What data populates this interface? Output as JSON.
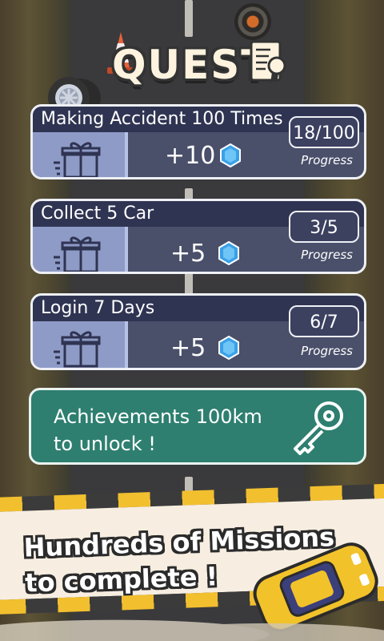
{
  "title": "QUEST",
  "quests": [
    {
      "name": "Making Accident 100 Times",
      "reward": "+10",
      "progress_value": "18/100",
      "progress_label": "Progress"
    },
    {
      "name": "Collect 5 Car",
      "reward": "+5",
      "progress_value": "3/5",
      "progress_label": "Progress"
    },
    {
      "name": "Login 7 Days",
      "reward": "+5",
      "progress_value": "6/7",
      "progress_label": "Progress"
    }
  ],
  "achievement": {
    "line1": "Achievements 100km",
    "line2": "to unlock !"
  },
  "banner": {
    "line1": "Hundreds of Missions",
    "line2": "to complete !"
  },
  "colors": {
    "card_bg": "#4a4f6a",
    "card_header": "#2f3452",
    "gift_cell": "#8f9bc7",
    "gem": "#3aa0e8",
    "achievement_bg": "#2e7f70",
    "banner_stripe_yellow": "#f2bf2e",
    "car_yellow": "#f2c22a"
  },
  "icons": [
    "tire-icon",
    "traffic-cone-icon",
    "certificate-icon",
    "gift-icon",
    "gem-icon",
    "key-icon",
    "car-icon"
  ]
}
